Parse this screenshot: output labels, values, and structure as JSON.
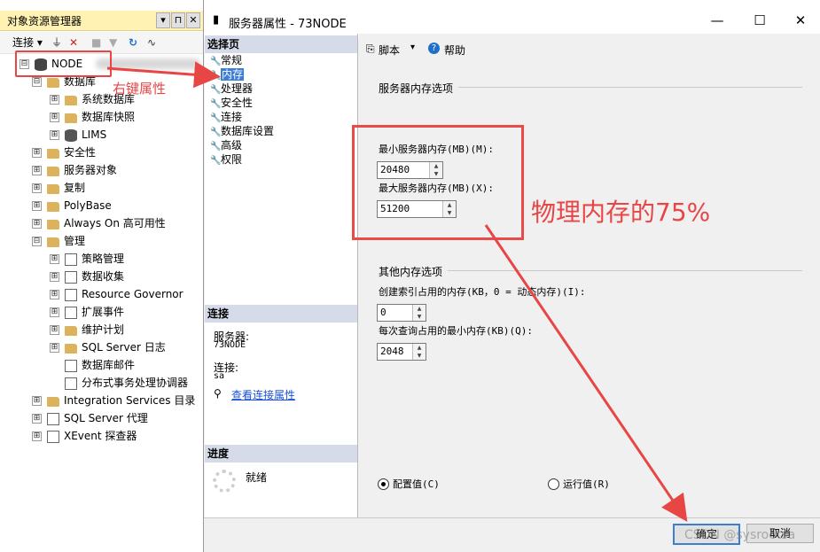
{
  "object_explorer": {
    "title": "对象资源管理器",
    "pin": "▾ ⊓",
    "close": "✕",
    "toolbar": {
      "connect": "连接",
      "refresh": "↻"
    },
    "root": "NODE",
    "tree": [
      {
        "label": "数据库",
        "level": 1,
        "exp": "⊟",
        "icon": "folder"
      },
      {
        "label": "系统数据库",
        "level": 2,
        "exp": "⊞",
        "icon": "folder"
      },
      {
        "label": "数据库快照",
        "level": 2,
        "exp": "⊞",
        "icon": "folder"
      },
      {
        "label": "LIMS",
        "level": 2,
        "exp": "⊞",
        "icon": "db"
      },
      {
        "label": "安全性",
        "level": 1,
        "exp": "⊞",
        "icon": "folder"
      },
      {
        "label": "服务器对象",
        "level": 1,
        "exp": "⊞",
        "icon": "folder"
      },
      {
        "label": "复制",
        "level": 1,
        "exp": "⊞",
        "icon": "folder"
      },
      {
        "label": "PolyBase",
        "level": 1,
        "exp": "⊞",
        "icon": "folder"
      },
      {
        "label": "Always On 高可用性",
        "level": 1,
        "exp": "⊞",
        "icon": "folder"
      },
      {
        "label": "管理",
        "level": 1,
        "exp": "⊟",
        "icon": "folder"
      },
      {
        "label": "策略管理",
        "level": 2,
        "exp": "⊞",
        "icon": "gen"
      },
      {
        "label": "数据收集",
        "level": 2,
        "exp": "⊞",
        "icon": "gen"
      },
      {
        "label": "Resource Governor",
        "level": 2,
        "exp": "⊞",
        "icon": "gen"
      },
      {
        "label": "扩展事件",
        "level": 2,
        "exp": "⊞",
        "icon": "gen"
      },
      {
        "label": "维护计划",
        "level": 2,
        "exp": "⊞",
        "icon": "folder"
      },
      {
        "label": "SQL Server 日志",
        "level": 2,
        "exp": "⊞",
        "icon": "folder"
      },
      {
        "label": "数据库邮件",
        "level": 2,
        "exp": "",
        "icon": "gen"
      },
      {
        "label": "分布式事务处理协调器",
        "level": 2,
        "exp": "",
        "icon": "gen"
      },
      {
        "label": "Integration Services 目录",
        "level": 1,
        "exp": "⊞",
        "icon": "folder"
      },
      {
        "label": "SQL Server 代理",
        "level": 1,
        "exp": "⊞",
        "icon": "gen"
      },
      {
        "label": "XEvent 探查器",
        "level": 1,
        "exp": "⊞",
        "icon": "gen"
      }
    ]
  },
  "dialog": {
    "title": "服务器属性 - 73NODE",
    "controls": {
      "min": "—",
      "max": "☐",
      "close": "✕"
    },
    "left": {
      "select_page_header": "选择页",
      "pages": [
        "常规",
        "内存",
        "处理器",
        "安全性",
        "连接",
        "数据库设置",
        "高级",
        "权限"
      ],
      "selected_index": 1,
      "connection_header": "连接",
      "server_label": "服务器:",
      "server_value": "73NODE",
      "connection_label": "连接:",
      "connection_value": "sa",
      "view_props_link": "查看连接属性",
      "progress_header": "进度",
      "progress_status": "就绪"
    },
    "toolbar": {
      "script": "脚本",
      "help": "帮助"
    },
    "memory": {
      "server_memory_group": "服务器内存选项",
      "min_label": "最小服务器内存(MB)(M):",
      "min_value": "20480",
      "max_label": "最大服务器内存(MB)(X):",
      "max_value": "51200",
      "other_group": "其他内存选项",
      "index_label": "创建索引占用的内存(KB，0 = 动态内存)(I):",
      "index_value": "0",
      "query_label": "每次查询占用的最小内存(KB)(Q):",
      "query_value": "2048",
      "configured_label": "配置值(C)",
      "running_label": "运行值(R)"
    },
    "buttons": {
      "ok": "确定",
      "cancel": "取消"
    }
  },
  "annotations": {
    "right_click_note": "右键属性",
    "memory_note": "物理内存的75%",
    "watermark": "CSDN @sysrootsa",
    "color": "#e84545"
  }
}
